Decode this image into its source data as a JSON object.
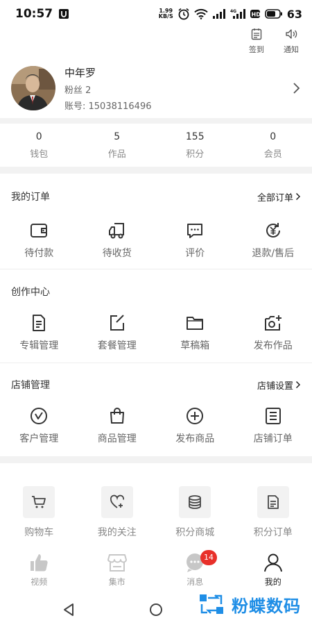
{
  "status_bar": {
    "time": "10:57",
    "speed_value": "1.99",
    "speed_unit": "KB/S",
    "battery": "63"
  },
  "top_actions": [
    {
      "label": "签到",
      "icon": "checkin-icon"
    },
    {
      "label": "通知",
      "icon": "speaker-icon"
    }
  ],
  "profile": {
    "name": "中年罗",
    "fans": "粉丝 2",
    "account": "账号: 15038116496"
  },
  "stats": [
    {
      "value": "0",
      "label": "钱包"
    },
    {
      "value": "5",
      "label": "作品"
    },
    {
      "value": "155",
      "label": "积分"
    },
    {
      "value": "0",
      "label": "会员"
    }
  ],
  "orders": {
    "title": "我的订单",
    "link": "全部订单",
    "items": [
      {
        "label": "待付款",
        "icon": "wallet-icon"
      },
      {
        "label": "待收货",
        "icon": "delivery-truck-icon"
      },
      {
        "label": "评价",
        "icon": "comment-icon"
      },
      {
        "label": "退款/售后",
        "icon": "refund-icon"
      }
    ]
  },
  "creation": {
    "title": "创作中心",
    "items": [
      {
        "label": "专辑管理",
        "icon": "document-icon"
      },
      {
        "label": "套餐管理",
        "icon": "edit-icon"
      },
      {
        "label": "草稿箱",
        "icon": "folder-icon"
      },
      {
        "label": "发布作品",
        "icon": "camera-add-icon"
      }
    ]
  },
  "store": {
    "title": "店铺管理",
    "link": "店铺设置",
    "items": [
      {
        "label": "客户管理",
        "icon": "compass-icon"
      },
      {
        "label": "商品管理",
        "icon": "shopping-bag-icon"
      },
      {
        "label": "发布商品",
        "icon": "plus-circle-icon"
      },
      {
        "label": "店铺订单",
        "icon": "order-list-icon"
      }
    ]
  },
  "tools": [
    {
      "label": "购物车",
      "icon": "cart-icon"
    },
    {
      "label": "我的关注",
      "icon": "heart-plus-icon"
    },
    {
      "label": "积分商城",
      "icon": "coins-icon"
    },
    {
      "label": "积分订单",
      "icon": "points-order-icon"
    }
  ],
  "bottom_nav": [
    {
      "label": "视频",
      "icon": "thumbs-up-icon"
    },
    {
      "label": "集市",
      "icon": "market-icon"
    },
    {
      "label": "消息",
      "icon": "message-icon",
      "badge": "14"
    },
    {
      "label": "我的",
      "icon": "person-icon",
      "active": true
    }
  ],
  "watermark": {
    "text": "粉蝶数码"
  },
  "colors": {
    "badge": "#e8302a",
    "watermark": "#1f8ee6",
    "divider_bg": "#f2f2f2"
  }
}
